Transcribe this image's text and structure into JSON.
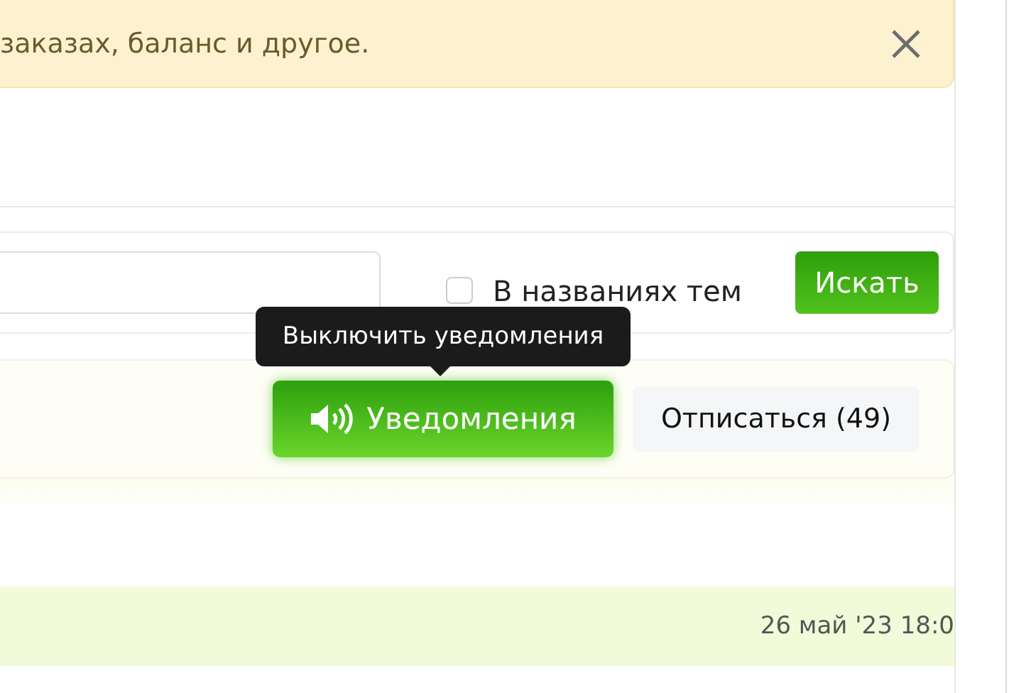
{
  "notice": {
    "text": "заказах, баланс и другое."
  },
  "search": {
    "checkbox": {
      "label": "В названиях тем",
      "checked": false
    },
    "button": "Искать"
  },
  "thread_actions": {
    "tooltip": "Выключить уведомления",
    "notifications": {
      "label": "Уведомления",
      "on": true
    },
    "unsubscribe": "Отписаться (49)"
  },
  "post": {
    "date": "26 май '23 18:0"
  }
}
